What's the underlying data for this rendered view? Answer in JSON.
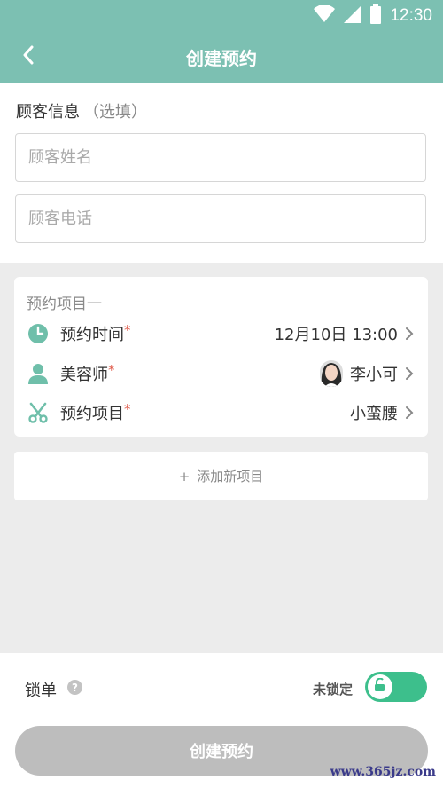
{
  "status_bar": {
    "time": "12:30"
  },
  "nav": {
    "title": "创建预约",
    "back_icon": "chevron-left-icon"
  },
  "customer": {
    "section_title": "顾客信息",
    "optional_label": "（选填）",
    "name_placeholder": "顾客姓名",
    "phone_placeholder": "顾客电话"
  },
  "appointment": {
    "card_title": "预约项目一",
    "rows": [
      {
        "label": "预约时间",
        "required": "*",
        "value": "12月10日 13:00",
        "icon": "clock-icon"
      },
      {
        "label": "美容师",
        "required": "*",
        "value": "李小可",
        "icon": "user-icon"
      },
      {
        "label": "预约项目",
        "required": "*",
        "value": "小蛮腰",
        "icon": "scissors-icon"
      }
    ]
  },
  "add_item": {
    "plus": "+",
    "label": "添加新项目"
  },
  "lock": {
    "label": "锁单",
    "help": "?",
    "status": "未锁定",
    "toggle_on": true
  },
  "submit": {
    "label": "创建预约"
  },
  "watermark": "www.365jz.com",
  "colors": {
    "header": "#7cc0b2",
    "accent": "#6fbfaa",
    "toggle": "#3dbf8c",
    "required": "#e05a4a",
    "disabled_button": "#bdbdbd"
  }
}
